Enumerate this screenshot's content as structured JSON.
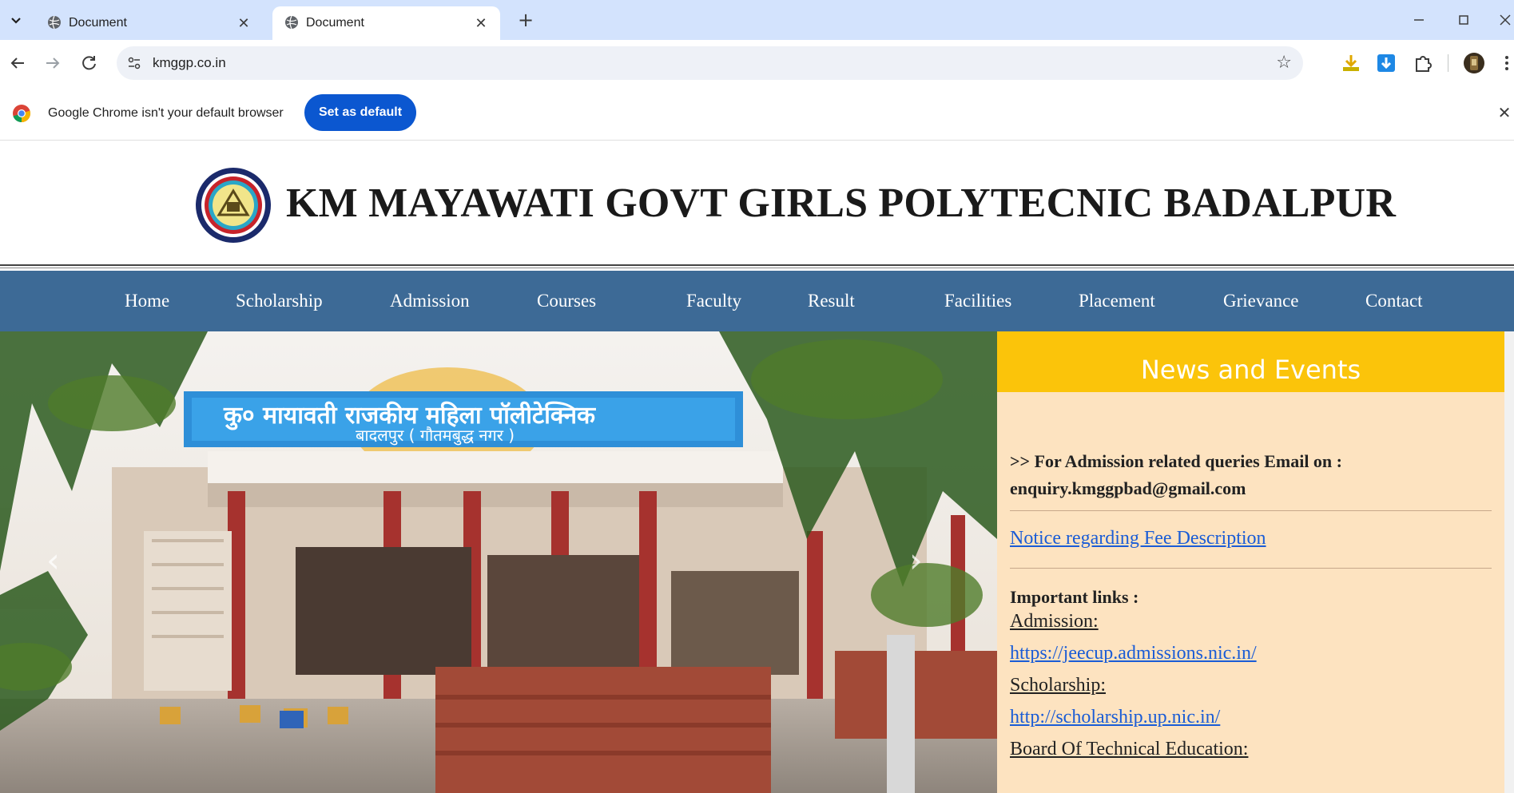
{
  "browser": {
    "tabs": [
      {
        "title": "Document",
        "active": false
      },
      {
        "title": "Document",
        "active": true
      }
    ],
    "new_tab_symbol": "+",
    "url": "kmggp.co.in",
    "infobar": {
      "message": "Google Chrome isn't your default browser",
      "button_label": "Set as default"
    }
  },
  "site": {
    "title": "KM MAYAWATI GOVT GIRLS POLYTECNIC BADALPUR",
    "nav": [
      "Home",
      "Scholarship",
      "Admission",
      "Courses",
      "Faculty",
      "Result",
      "Facilities",
      "Placement",
      "Grievance",
      "Contact"
    ],
    "hero_sign": {
      "line1": "कु० मायावती राजकीय महिला पॉलीटेक्निक",
      "line2": "बादलपुर ( गौतमबुद्ध नगर )"
    },
    "news": {
      "heading": "News and Events",
      "admission_query": ">> For Admission related queries Email on :",
      "admission_email": "enquiry.kmggpbad@gmail.com",
      "notice_link": "Notice regarding Fee Description",
      "important_links_label": "Important links :",
      "admission_label": "Admission:",
      "admission_url": "https://jeecup.admissions.nic.in/",
      "scholarship_label": "Scholarship:",
      "scholarship_url": "http://scholarship.up.nic.in/",
      "bte_label": "Board Of Technical Education:"
    }
  },
  "colors": {
    "tabstrip": "#d3e3fd",
    "nav_bar": "#3d6a96",
    "news_header": "#fbc40a",
    "news_body": "#fde3c0",
    "link": "#1a5cd6",
    "primary_button": "#0b57d0"
  }
}
